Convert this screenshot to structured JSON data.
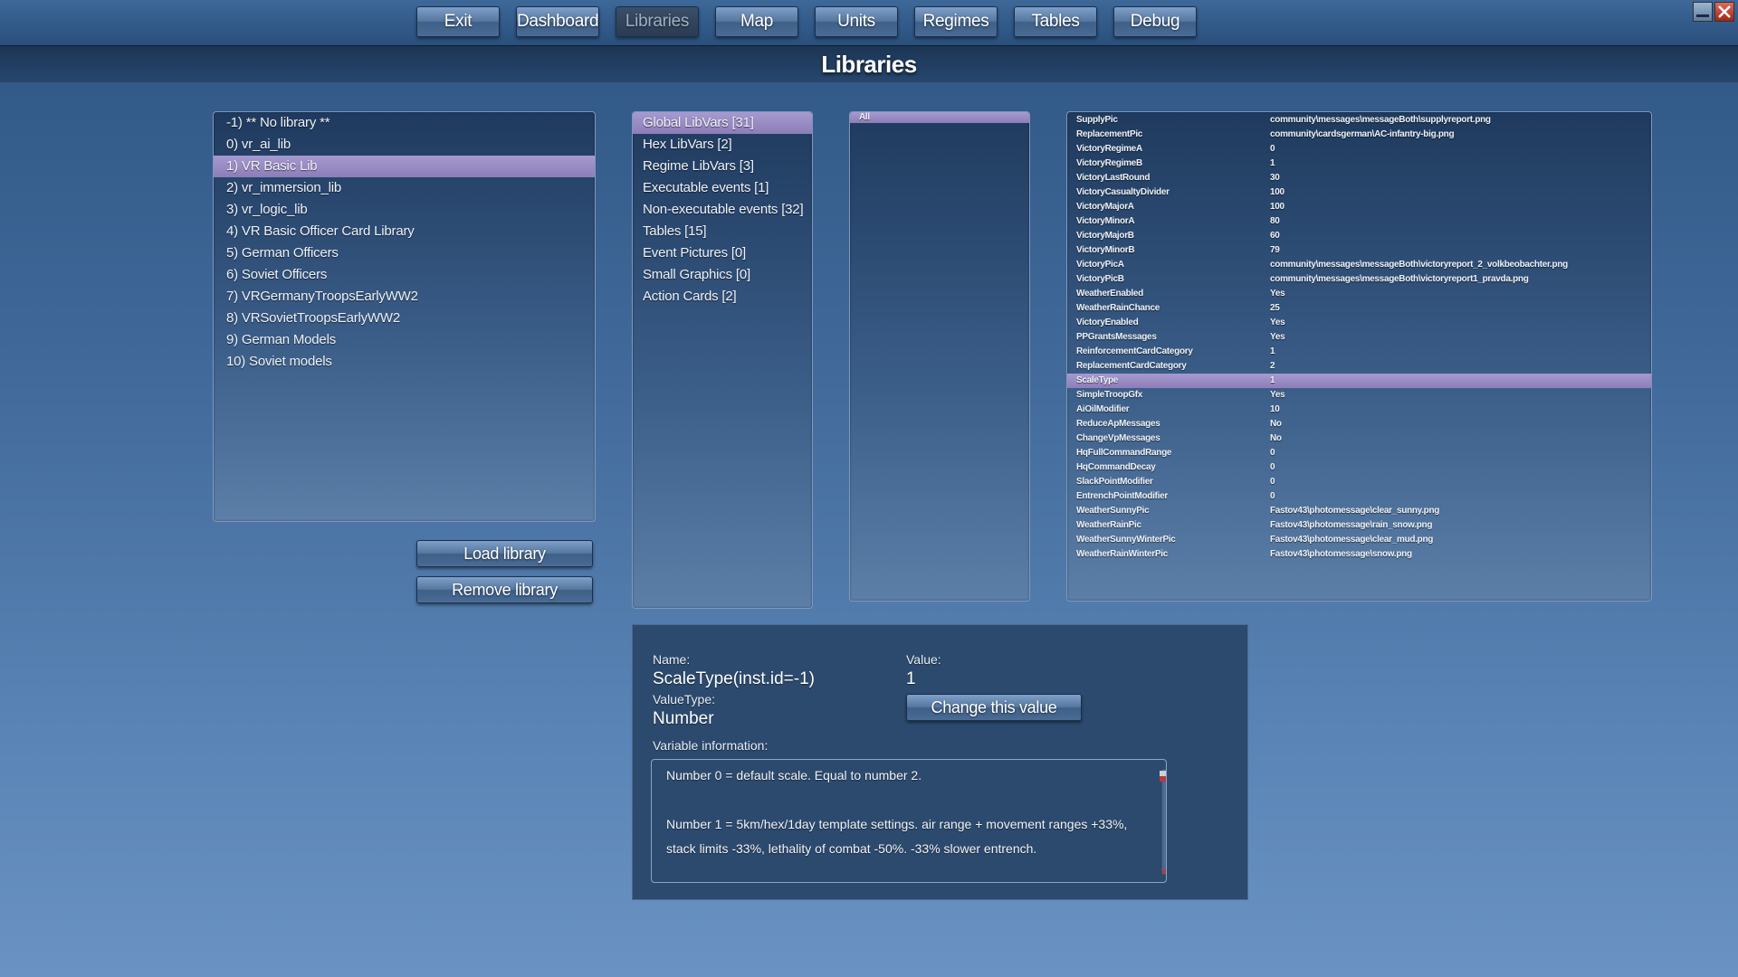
{
  "nav": {
    "buttons": [
      "Exit",
      "Dashboard",
      "Libraries",
      "Map",
      "Units",
      "Regimes",
      "Tables",
      "Debug"
    ],
    "active": "Libraries"
  },
  "page_title": "Libraries",
  "libraries": {
    "items": [
      "-1) ** No library **",
      "0) vr_ai_lib",
      "1) VR Basic Lib",
      "2) vr_immersion_lib",
      "3) vr_logic_lib",
      "4) VR Basic Officer Card Library",
      "5) German Officers",
      "6) Soviet Officers",
      "7) VRGermanyTroopsEarlyWW2",
      "8) VRSovietTroopsEarlyWW2",
      "9) German Models",
      "10) Soviet models"
    ],
    "selected_index": 2,
    "load_label": "Load library",
    "remove_label": "Remove library"
  },
  "categories": {
    "items": [
      "Global LibVars [31]",
      "Hex LibVars [2]",
      "Regime LibVars [3]",
      "Executable events [1]",
      "Non-executable events [32]",
      "Tables [15]",
      "Event Pictures [0]",
      "Small Graphics [0]",
      "Action Cards [2]"
    ],
    "selected_index": 0
  },
  "filter": {
    "items": [
      "All"
    ],
    "selected_index": 0
  },
  "variables": {
    "rows": [
      {
        "key": "SupplyPic",
        "value": "community\\messages\\messageBoth\\supplyreport.png"
      },
      {
        "key": "ReplacementPic",
        "value": "community\\cardsgerman\\AC-infantry-big.png"
      },
      {
        "key": "VictoryRegimeA",
        "value": "0"
      },
      {
        "key": "VictoryRegimeB",
        "value": "1"
      },
      {
        "key": "VictoryLastRound",
        "value": "30"
      },
      {
        "key": "VictoryCasualtyDivider",
        "value": "100"
      },
      {
        "key": "VictoryMajorA",
        "value": "100"
      },
      {
        "key": "VictoryMinorA",
        "value": "80"
      },
      {
        "key": "VictoryMajorB",
        "value": "60"
      },
      {
        "key": "VictoryMinorB",
        "value": "79"
      },
      {
        "key": "VictoryPicA",
        "value": "community\\messages\\messageBoth\\victoryreport_2_volkbeobachter.png"
      },
      {
        "key": "VictoryPicB",
        "value": "community\\messages\\messageBoth\\victoryreport1_pravda.png"
      },
      {
        "key": "WeatherEnabled",
        "value": "Yes"
      },
      {
        "key": "WeatherRainChance",
        "value": "25"
      },
      {
        "key": "VictoryEnabled",
        "value": "Yes"
      },
      {
        "key": "PPGrantsMessages",
        "value": "Yes"
      },
      {
        "key": "ReinforcementCardCategory",
        "value": "1"
      },
      {
        "key": "ReplacementCardCategory",
        "value": "2"
      },
      {
        "key": "ScaleType",
        "value": "1"
      },
      {
        "key": "SimpleTroopGfx",
        "value": "Yes"
      },
      {
        "key": "AiOilModifier",
        "value": "10"
      },
      {
        "key": "ReduceApMessages",
        "value": "No"
      },
      {
        "key": "ChangeVpMessages",
        "value": "No"
      },
      {
        "key": "HqFullCommandRange",
        "value": "0"
      },
      {
        "key": "HqCommandDecay",
        "value": "0"
      },
      {
        "key": "SlackPointModifier",
        "value": "0"
      },
      {
        "key": "EntrenchPointModifier",
        "value": "0"
      },
      {
        "key": "WeatherSunnyPic",
        "value": "Fastov43\\photomessage\\clear_sunny.png"
      },
      {
        "key": "WeatherRainPic",
        "value": "Fastov43\\photomessage\\rain_snow.png"
      },
      {
        "key": "WeatherSunnyWinterPic",
        "value": "Fastov43\\photomessage\\clear_mud.png"
      },
      {
        "key": "WeatherRainWinterPic",
        "value": "Fastov43\\photomessage\\snow.png"
      }
    ],
    "selected_index": 18
  },
  "details": {
    "name_label": "Name:",
    "name_value": "ScaleType(inst.id=-1)",
    "valuetype_label": "ValueType:",
    "valuetype_value": "Number",
    "value_label": "Value:",
    "value_value": "1",
    "change_label": "Change this value",
    "info_label": "Variable information:",
    "info_text": [
      "Number 0 = default scale. Equal to number 2.",
      "",
      "Number 1 = 5km/hex/1day template settings. air range + movement ranges +33%, stack limits -33%, lethality of combat -50%. -33% slower entrench."
    ]
  },
  "colors": {
    "background": "#4a74a6",
    "selection": "#9a8bc6",
    "title_bar": "#1f3a5c"
  }
}
